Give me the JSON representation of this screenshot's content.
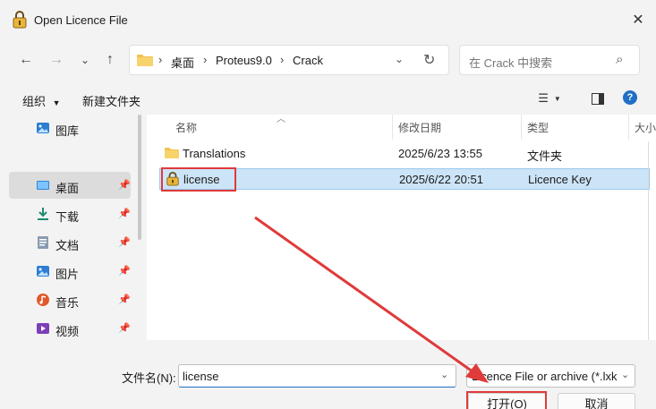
{
  "window": {
    "title": "Open Licence File"
  },
  "nav": {
    "breadcrumbs": [
      "桌面",
      "Proteus9.0",
      "Crack"
    ],
    "search_placeholder": "在 Crack 中搜索"
  },
  "toolbar": {
    "organize": "组织",
    "new_folder": "新建文件夹"
  },
  "sidebar": {
    "items": [
      {
        "label": "图库",
        "icon": "gallery-icon"
      },
      {
        "label": "桌面",
        "icon": "desktop-icon",
        "selected": true
      },
      {
        "label": "下载",
        "icon": "download-icon"
      },
      {
        "label": "文档",
        "icon": "document-icon"
      },
      {
        "label": "图片",
        "icon": "pictures-icon"
      },
      {
        "label": "音乐",
        "icon": "music-icon"
      },
      {
        "label": "视频",
        "icon": "video-icon"
      }
    ]
  },
  "columns": {
    "name": "名称",
    "date": "修改日期",
    "type": "类型",
    "size": "大小"
  },
  "files": [
    {
      "name": "Translations",
      "date": "2025/6/23 13:55",
      "type": "文件夹",
      "icon": "folder-icon"
    },
    {
      "name": "license",
      "date": "2025/6/22 20:51",
      "type": "Licence Key",
      "icon": "license-key-icon",
      "selected": true
    }
  ],
  "bottom": {
    "filename_label": "文件名(N):",
    "filename_value": "license",
    "filter_value": "Licence File or archive (*.lxk",
    "open_button": "打开(O)",
    "cancel_button": "取消"
  },
  "colors": {
    "accent": "#1f6fc4",
    "annotation": "#e03a3a",
    "selection": "#cce4f7"
  }
}
